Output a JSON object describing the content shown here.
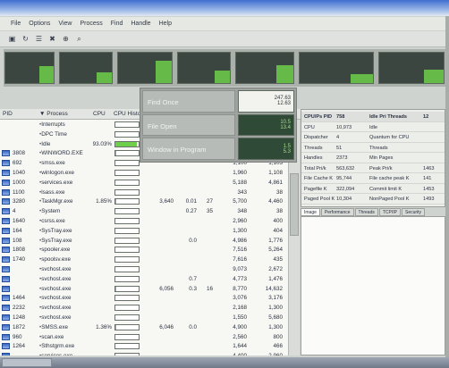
{
  "menu": {
    "items": [
      "File",
      "Options",
      "View",
      "Process",
      "Find",
      "Handle",
      "Help"
    ]
  },
  "toolbar": {
    "icons": [
      "save-icon",
      "refresh-icon",
      "properties-icon",
      "kill-icon",
      "target-icon",
      "find-icon"
    ]
  },
  "graphs": {
    "levels": [
      0.55,
      0.35,
      0.75,
      0.4,
      0.6,
      0.3,
      0.45
    ]
  },
  "popup": {
    "items": [
      {
        "label": "Find Once",
        "values": [
          "247.63",
          "12.63"
        ]
      },
      {
        "label": "File Open",
        "values": [
          "10.5",
          "13.4"
        ]
      },
      {
        "label": "Window in Program",
        "values": [
          "1.5",
          "5.3"
        ]
      }
    ]
  },
  "list": {
    "columns": [
      "PID",
      "▼ Process",
      "CPU",
      "CPU History"
    ],
    "rows": [
      {
        "icon": "",
        "pid": "",
        "name": "Interrupts",
        "cpu": "",
        "hist": 0,
        "cells": [
          "",
          "",
          "",
          "",
          ""
        ]
      },
      {
        "icon": "",
        "pid": "",
        "name": "DPC Time",
        "cpu": "",
        "hist": 0,
        "cells": [
          "",
          "",
          "",
          "",
          ""
        ]
      },
      {
        "icon": "",
        "pid": "",
        "name": "Idle",
        "cpu": "93.03%",
        "hist": 0.93,
        "cells": [
          "",
          "",
          "",
          "",
          ""
        ]
      },
      {
        "icon": "app-icon",
        "pid": "3808",
        "name": "WINWORD.EXE",
        "cpu": "",
        "hist": 0.02,
        "cells": [
          "",
          "",
          "",
          "",
          ""
        ]
      },
      {
        "icon": "app-icon",
        "pid": "692",
        "name": "smss.exe",
        "cpu": "",
        "hist": 0,
        "cells": [
          "",
          "",
          "",
          "1,100",
          "1,103"
        ]
      },
      {
        "icon": "app-icon",
        "pid": "1040",
        "name": "winlogon.exe",
        "cpu": "",
        "hist": 0,
        "cells": [
          "",
          "",
          "",
          "1,960",
          "1,108"
        ]
      },
      {
        "icon": "app-icon",
        "pid": "1000",
        "name": "services.exe",
        "cpu": "",
        "hist": 0,
        "cells": [
          "",
          "",
          "",
          "5,188",
          "4,861"
        ]
      },
      {
        "icon": "app-icon",
        "pid": "1100",
        "name": "lsass.exe",
        "cpu": "",
        "hist": 0,
        "cells": [
          "",
          "",
          "",
          "343",
          "38"
        ]
      },
      {
        "icon": "app-icon",
        "pid": "3280",
        "name": "TaskMgr.exe",
        "cpu": "1.85%",
        "hist": 0.05,
        "cells": [
          "3,640",
          "0.01",
          "27",
          "5,700",
          "4,460"
        ]
      },
      {
        "icon": "app-icon",
        "pid": "4",
        "name": "System",
        "cpu": "",
        "hist": 0,
        "cells": [
          "",
          "0.27",
          "35",
          "348",
          "38"
        ]
      },
      {
        "icon": "app-icon",
        "pid": "1640",
        "name": "csrss.exe",
        "cpu": "",
        "hist": 0,
        "cells": [
          "",
          "",
          "",
          "2,960",
          "400"
        ]
      },
      {
        "icon": "app-icon",
        "pid": "164",
        "name": "SysTray.exe",
        "cpu": "",
        "hist": 0,
        "cells": [
          "",
          "",
          "",
          "1,300",
          "404"
        ]
      },
      {
        "icon": "app-icon",
        "pid": "108",
        "name": "SysTray.exe",
        "cpu": "",
        "hist": 0,
        "cells": [
          "",
          "0.0",
          "",
          "4,986",
          "1,776"
        ]
      },
      {
        "icon": "app-icon",
        "pid": "1808",
        "name": "spooler.exe",
        "cpu": "",
        "hist": 0,
        "cells": [
          "",
          "",
          "",
          "7,516",
          "5,264"
        ]
      },
      {
        "icon": "app-icon",
        "pid": "1740",
        "name": "spoolsv.exe",
        "cpu": "",
        "hist": 0,
        "cells": [
          "",
          "",
          "",
          "7,616",
          "435"
        ]
      },
      {
        "icon": "app-icon",
        "pid": "",
        "name": "svchost.exe",
        "cpu": "",
        "hist": 0,
        "cells": [
          "",
          "",
          "",
          "9,073",
          "2,672"
        ]
      },
      {
        "icon": "app-icon",
        "pid": "",
        "name": "svchost.exe",
        "cpu": "",
        "hist": 0,
        "cells": [
          "",
          "0.7",
          "",
          "4,773",
          "1,476"
        ]
      },
      {
        "icon": "app-icon",
        "pid": "",
        "name": "svchost.exe",
        "cpu": "",
        "hist": 0.03,
        "cells": [
          "6,056",
          "0.3",
          "16",
          "8,770",
          "14,632"
        ]
      },
      {
        "icon": "app-icon",
        "pid": "1464",
        "name": "svchost.exe",
        "cpu": "",
        "hist": 0,
        "cells": [
          "",
          "",
          "",
          "3,076",
          "3,176"
        ]
      },
      {
        "icon": "app-icon",
        "pid": "2232",
        "name": "svchost.exe",
        "cpu": "",
        "hist": 0,
        "cells": [
          "",
          "",
          "",
          "2,168",
          "1,300"
        ]
      },
      {
        "icon": "app-icon",
        "pid": "1248",
        "name": "svchost.exe",
        "cpu": "",
        "hist": 0,
        "cells": [
          "",
          "",
          "",
          "1,550",
          "5,680"
        ]
      },
      {
        "icon": "app-icon",
        "pid": "1872",
        "name": "SMSS.exe",
        "cpu": "1.36%",
        "hist": 0.04,
        "cells": [
          "6,046",
          "0.0",
          "",
          "4,900",
          "1,300"
        ]
      },
      {
        "icon": "app-icon",
        "pid": "960",
        "name": "scan.exe",
        "cpu": "",
        "hist": 0,
        "cells": [
          "",
          "",
          "",
          "2,560",
          "800"
        ]
      },
      {
        "icon": "app-icon",
        "pid": "1264",
        "name": "Sthstgrm.exe",
        "cpu": "",
        "hist": 0,
        "cells": [
          "",
          "",
          "",
          "1,644",
          "466"
        ]
      },
      {
        "icon": "app-icon",
        "pid": "",
        "name": "services.exe",
        "cpu": "",
        "hist": 0,
        "cells": [
          "",
          "",
          "",
          "4,400",
          "2,960"
        ]
      }
    ]
  },
  "sysinfo": {
    "rows": [
      [
        "CPU/Ps PID",
        "758",
        "Idle Pri Threads",
        "12"
      ],
      [
        "CPU",
        "10,973",
        "Idle",
        ""
      ],
      [
        "Dispatcher",
        "4",
        "Quantum for CPU",
        ""
      ],
      [
        "Threads",
        "51",
        "Threads",
        ""
      ],
      [
        "Handles",
        "2373",
        "Min Pages",
        ""
      ],
      [
        "Total Pri/k",
        "563,632",
        "Peak Pri/k",
        "1463"
      ],
      [
        "File Cache K",
        "95,744",
        "File cache peak K",
        "141"
      ],
      [
        "Pagefile K",
        "322,094",
        "Commit limit K",
        "1453"
      ],
      [
        "Paged Pool K",
        "10,304",
        "NonPaged Pool K",
        "1493"
      ]
    ]
  },
  "tabs": [
    "Image",
    "Performance",
    "Threads",
    "TCP/IP",
    "Security"
  ],
  "colors": {
    "graph": "#6fcf4a",
    "accent": "#3f6fcf"
  }
}
